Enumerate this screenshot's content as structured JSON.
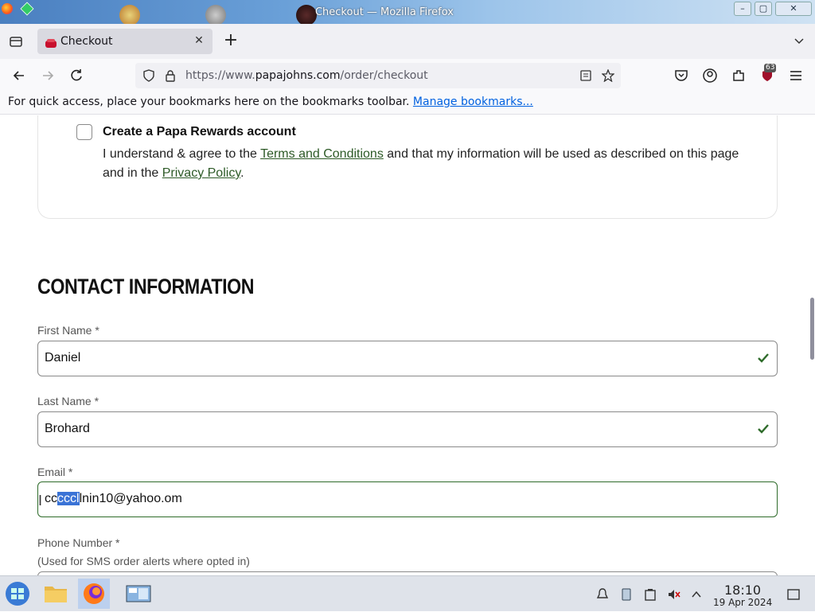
{
  "window": {
    "title": "Checkout — Mozilla Firefox",
    "minimize_label": "–",
    "restore_label": "▢",
    "close_label": "✕"
  },
  "tabs": [
    {
      "title": "Checkout",
      "close_label": "✕",
      "active": true
    }
  ],
  "new_tab_label": "+",
  "navbar": {
    "url_prefix": "https://www.",
    "url_domain": "papajohns.com",
    "url_path": "/order/checkout",
    "extension_badge": "63"
  },
  "bookmarks_bar": {
    "message": "For quick access, place your bookmarks here on the bookmarks toolbar.",
    "link": "Manage bookmarks..."
  },
  "rewards": {
    "title": "Create a Papa Rewards account",
    "text_before": "I understand & agree to the",
    "terms_link": "Terms and Conditions",
    "text_middle": "and that my information will be used as described on this page and in the",
    "privacy_link": "Privacy Policy",
    "text_after": ".",
    "checked": false
  },
  "contact": {
    "heading": "CONTACT INFORMATION",
    "first_name": {
      "label": "First Name *",
      "value": "Daniel"
    },
    "last_name": {
      "label": "Last Name *",
      "value": "Brohard"
    },
    "email": {
      "label": "Email *",
      "value_before": "cc",
      "value_selected": "cccl",
      "value_after": "lnin10@yahoo.om"
    },
    "phone": {
      "label": "Phone Number *",
      "sublabel": "(Used for SMS order alerts where opted in)"
    }
  },
  "colors": {
    "accent_green": "#2e6b2a",
    "link_blue": "#0061e0",
    "selection_blue": "#3a73d6"
  },
  "taskbar": {
    "time": "18:10",
    "date": "19 Apr 2024"
  }
}
